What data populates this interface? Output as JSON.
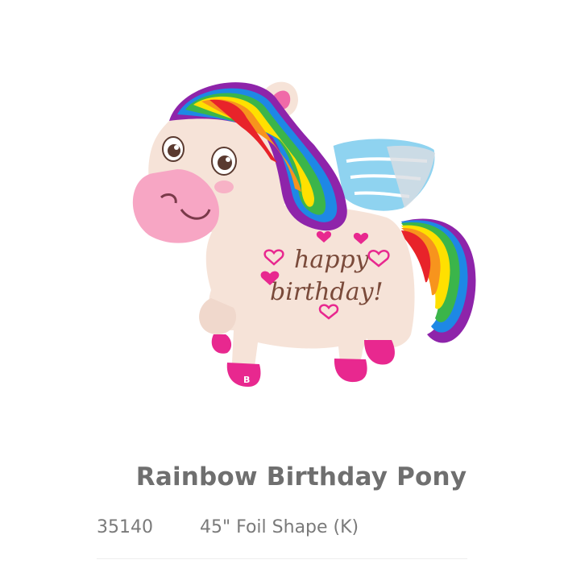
{
  "product": {
    "title": "Rainbow Birthday Pony",
    "sku": "35140",
    "description": "45\" Foil Shape (K)",
    "image": {
      "icon": "rainbow-pony-balloon",
      "balloon_text_line1": "happy",
      "balloon_text_line2": "birthday!",
      "brand_mark": "B",
      "colors": {
        "body": "#f6e3d8",
        "muzzle": "#f7a6c4",
        "hooves": "#e8288f",
        "wing": "#8fd3f0",
        "text": "#7a4a3a",
        "heart": "#e8288f"
      },
      "rainbow": [
        "#e8232a",
        "#f7941d",
        "#ffe000",
        "#3bb54a",
        "#1e88e5",
        "#8e24aa"
      ]
    }
  }
}
